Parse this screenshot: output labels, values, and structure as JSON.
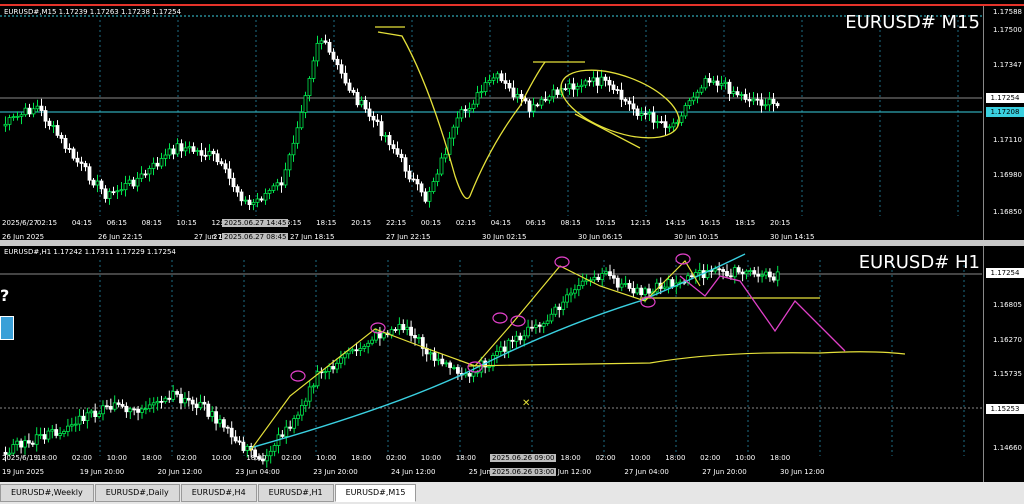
{
  "pane1": {
    "header": "EURUSD#,M15  1.17239 1.17263 1.17238 1.17254",
    "title": "EURUSD# M15",
    "price_labels": [
      "1.17588",
      "1.17500",
      "1.17347",
      "1.17254",
      "1.17208",
      "1.17110",
      "1.16980",
      "1.16850"
    ],
    "current_price": "1.17254",
    "line_price": "1.17208",
    "time_labels_top": [
      "2025/6/27",
      "02:15",
      "04:15",
      "06:15",
      "08:15",
      "10:15",
      "12:15",
      "14:15",
      "16:15",
      "18:15",
      "20:15",
      "22:15",
      "00:15",
      "02:15",
      "04:15",
      "06:15",
      "08:15",
      "10:15",
      "12:15",
      "14:15",
      "16:15",
      "18:15",
      "20:15"
    ],
    "crosshair_time_top": "2025.06.27 14:45",
    "date_labels": [
      "26 Jun 2025",
      "26 Jun 22:15",
      "27 Jun 14:15",
      "27 Jun 18:15",
      "27 Jun 22:15",
      "30 Jun 02:15",
      "30 Jun 06:15",
      "30 Jun 10:15",
      "30 Jun 14:15"
    ],
    "crosshair_date": "2025.06.27 08:45",
    "date_prefix": "27",
    "series_desc": "close prices approx"
  },
  "pane2": {
    "header": "EURUSD#,H1  1.17242 1.17311 1.17229 1.17254",
    "title": "EURUSD# H1",
    "price_labels": [
      "1.17254",
      "1.16805",
      "1.16270",
      "1.15735",
      "1.15253",
      "1.14660"
    ],
    "current_price": "1.17254",
    "line_price": "1.15253",
    "time_labels_top": [
      "2025/6/19",
      "18:00",
      "02:00",
      "10:00",
      "18:00",
      "02:00",
      "10:00",
      "18:00",
      "02:00",
      "10:00",
      "18:00",
      "02:00",
      "10:00",
      "18:00",
      "02:00",
      "10:00",
      "18:00",
      "02:00",
      "10:00",
      "18:00",
      "02:00",
      "10:00",
      "18:00"
    ],
    "crosshair_time_top": "2025.06.26 09:00",
    "date_labels": [
      "19 Jun 2025",
      "19 Jun 20:00",
      "20 Jun 12:00",
      "23 Jun 04:00",
      "23 Jun 20:00",
      "24 Jun 12:00",
      "25 Jun 04:00",
      "26 Jun 12:00",
      "27 Jun 04:00",
      "27 Jun 20:00",
      "30 Jun 12:00"
    ],
    "crosshair_date": "2025.06.26 03:00"
  },
  "tabs": [
    "EURUSD#,Weekly",
    "EURUSD#,Daily",
    "EURUSD#,H4",
    "EURUSD#,H1",
    "EURUSD#,M15"
  ],
  "active_tab": "EURUSD#,M15",
  "colors": {
    "bull": "#ffffff",
    "bear": "#ffffff",
    "green": "#00e64d",
    "cyan": "#3ad0e0",
    "yellow": "#e5e13a",
    "magenta": "#e040c8",
    "grid": "#1e6e86",
    "accent": "#e5332a"
  }
}
